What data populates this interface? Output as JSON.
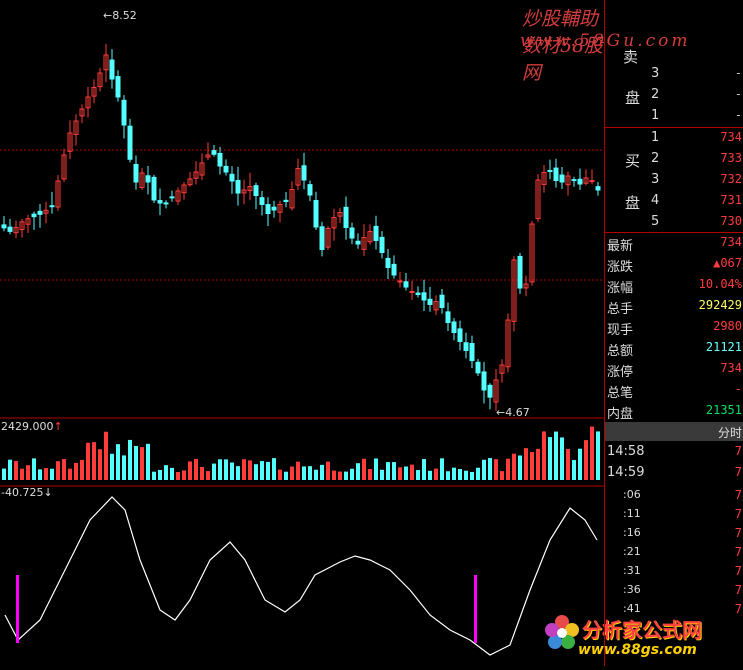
{
  "watermark": {
    "top_line": "炒股輔助数材58股网",
    "url_line": "www.58Gu.com",
    "bottom_logo": "分析家公式网",
    "bottom_url": "www.88gs.com"
  },
  "price_panel": {
    "high_marker": "8.52",
    "low_marker": "4.67"
  },
  "volume_panel": {
    "value_label": "2429.000",
    "arrow": "↑"
  },
  "indicator_panel": {
    "value_label": "-40.725",
    "arrow": "↓"
  },
  "colors": {
    "up": "#ff3c3c",
    "down": "#54ffff",
    "grid": "#b00000",
    "indicator_line": "#ffffff",
    "signal_bar": "#ff00ff"
  },
  "order_book": {
    "sell_label_a": "卖",
    "sell_label_b": "盘",
    "sell": [
      {
        "level": "3",
        "price": "-"
      },
      {
        "level": "2",
        "price": "-"
      },
      {
        "level": "1",
        "price": "-"
      }
    ],
    "buy_label_a": "买",
    "buy_label_b": "盘",
    "buy": [
      {
        "level": "1",
        "price": "734"
      },
      {
        "level": "2",
        "price": "733"
      },
      {
        "level": "3",
        "price": "732"
      },
      {
        "level": "4",
        "price": "731"
      },
      {
        "level": "5",
        "price": "730"
      }
    ]
  },
  "quote": [
    {
      "label": "最新",
      "value": "734",
      "color": "red"
    },
    {
      "label": "涨跌",
      "value": "▲067",
      "color": "red"
    },
    {
      "label": "涨幅",
      "value": "10.04%",
      "color": "red"
    },
    {
      "label": "总手",
      "value": "292429",
      "color": "yel"
    },
    {
      "label": "现手",
      "value": "2980",
      "color": "red"
    },
    {
      "label": "总额",
      "value": "21121",
      "color": "cyn"
    },
    {
      "label": "涨停",
      "value": "734",
      "color": "red"
    },
    {
      "label": "总笔",
      "value": "-",
      "color": "red"
    },
    {
      "label": "内盘",
      "value": "21351",
      "color": "grn"
    }
  ],
  "ticks_header": "分时",
  "ticks": [
    {
      "time": "14:58",
      "value": "7"
    },
    {
      "time": "14:59",
      "value": "7"
    },
    {
      "time": ":06",
      "value": "7"
    },
    {
      "time": ":11",
      "value": "7"
    },
    {
      "time": ":16",
      "value": "7"
    },
    {
      "time": ":21",
      "value": "7"
    },
    {
      "time": ":31",
      "value": "7"
    },
    {
      "time": ":36",
      "value": "7"
    },
    {
      "time": ":41",
      "value": "7"
    }
  ],
  "signal_bars": [
    {
      "bar_index": 2,
      "strength": 1
    },
    {
      "bar_index": 83,
      "strength": 1
    }
  ]
}
